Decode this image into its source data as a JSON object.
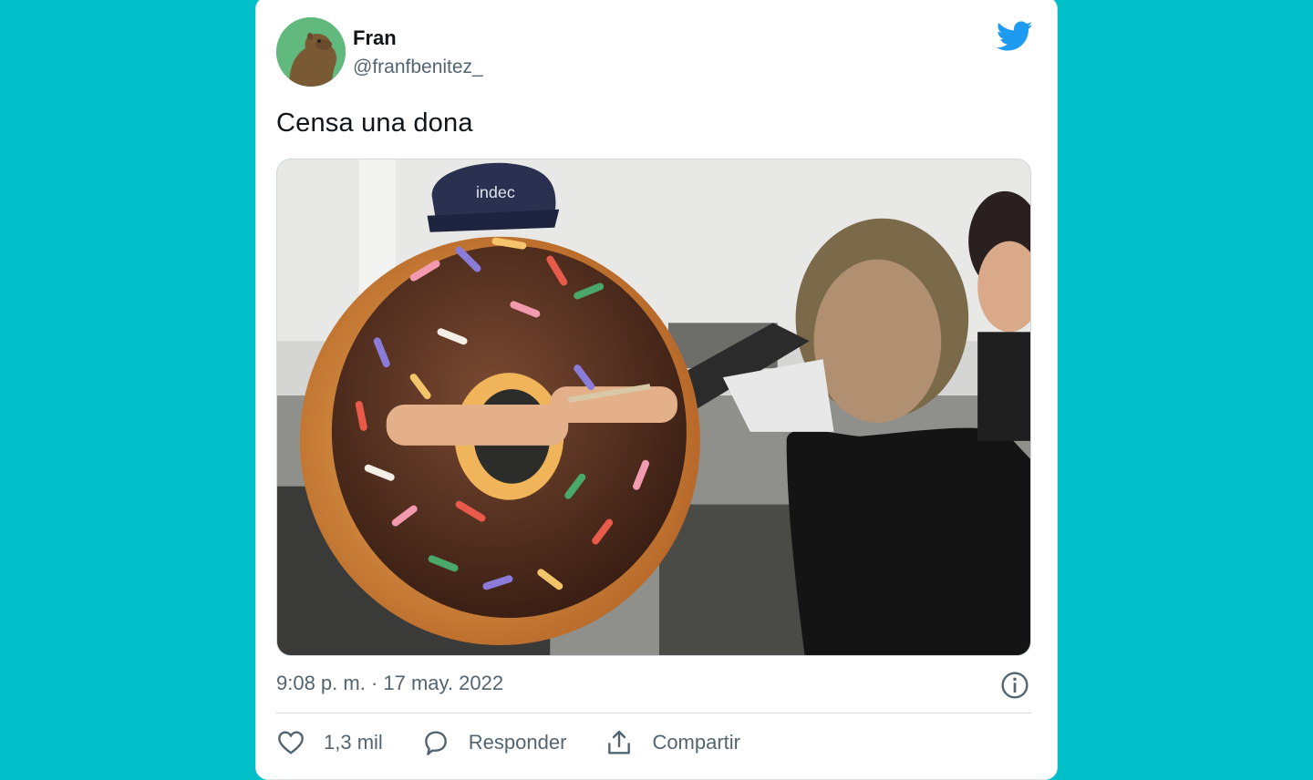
{
  "tweet": {
    "author_name": "Fran",
    "author_handle": "@franfbenitez_",
    "text": "Censa una dona",
    "timestamp": "9:08 p. m. · 17 may. 2022",
    "media": {
      "description_icon": "photo-icon",
      "cap_text": "indec"
    }
  },
  "actions": {
    "like_count": "1,3 mil",
    "reply_label": "Responder",
    "share_label": "Compartir"
  },
  "icons": {
    "logo": "twitter-bird-icon",
    "info": "info-icon",
    "like": "heart-icon",
    "reply": "reply-bubble-icon",
    "share": "share-icon"
  },
  "colors": {
    "background": "#00bfc8",
    "brand": "#1d9bf0",
    "text_primary": "#0f1419",
    "text_secondary": "#536471"
  }
}
